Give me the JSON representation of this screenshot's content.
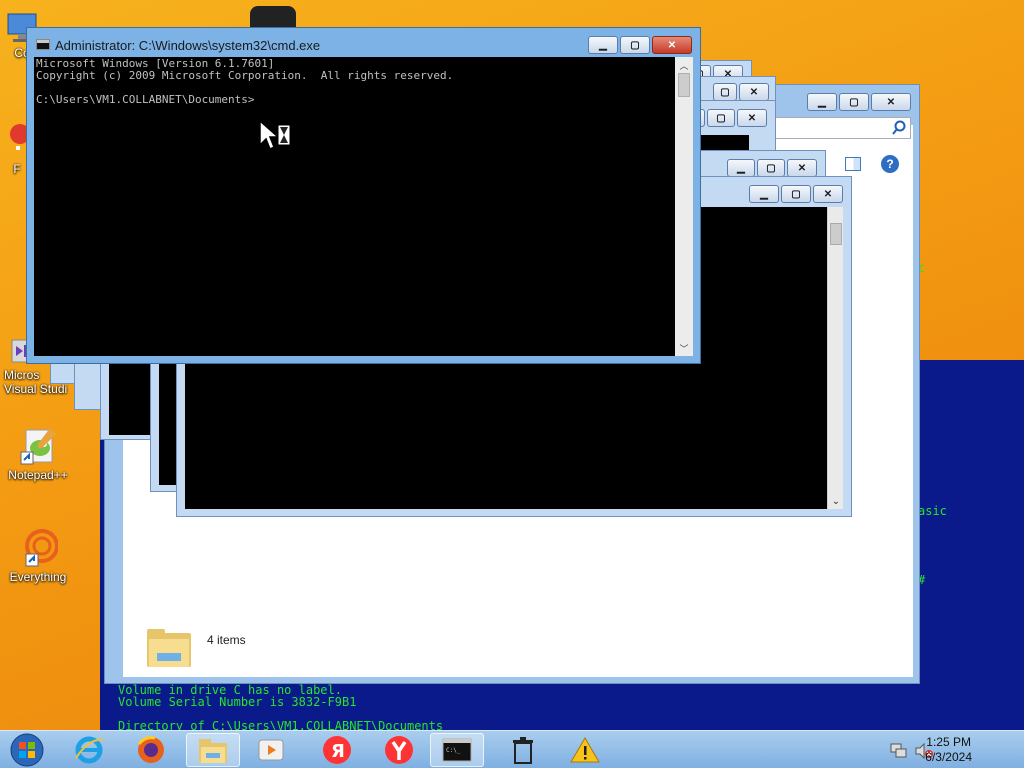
{
  "desktop": {
    "icons": [
      {
        "label": "Co",
        "name": "computer"
      },
      {
        "label": "F",
        "name": "f-shortcut"
      },
      {
        "label": "Micros Visual Studi",
        "name": "visual-studio"
      },
      {
        "label": "Notepad++",
        "name": "notepad-plus-plus"
      },
      {
        "label": "Everything",
        "name": "everything"
      }
    ]
  },
  "background_console": {
    "lines": [
      "Volume in drive C has no label.",
      "Volume Serial Number is 3832-F9B1",
      "Directory of C:\\Users\\VM1.COLLABNET\\Documents"
    ],
    "fragment_right_1": "asic",
    "fragment_right_2": "c",
    "fragment_right_3": "#"
  },
  "explorer": {
    "status_count": "4 items",
    "search_icon": "search-icon",
    "help_icon": "help-icon"
  },
  "cmd_window": {
    "title": "Administrator: C:\\Windows\\system32\\cmd.exe",
    "output": [
      "Microsoft Windows [Version 6.1.7601]",
      "Copyright (c) 2009 Microsoft Corporation.  All rights reserved.",
      "",
      "C:\\Users\\VM1.COLLABNET\\Documents>"
    ],
    "buttons": {
      "minimize": "−",
      "maximize": "□",
      "close": "✕"
    }
  },
  "taskbar": {
    "items": [
      {
        "name": "start-button"
      },
      {
        "name": "internet-explorer"
      },
      {
        "name": "firefox"
      },
      {
        "name": "file-explorer"
      },
      {
        "name": "media-player"
      },
      {
        "name": "yandex-browser"
      },
      {
        "name": "yandex"
      },
      {
        "name": "cmd"
      },
      {
        "name": "recycle-bin"
      },
      {
        "name": "warning"
      }
    ],
    "time": "1:25 PM",
    "date": "6/3/2024"
  },
  "colors": {
    "console_green": "#27e52a",
    "console_blue_bg": "#0a1a8a",
    "desktop_orange": "#f39a12"
  }
}
